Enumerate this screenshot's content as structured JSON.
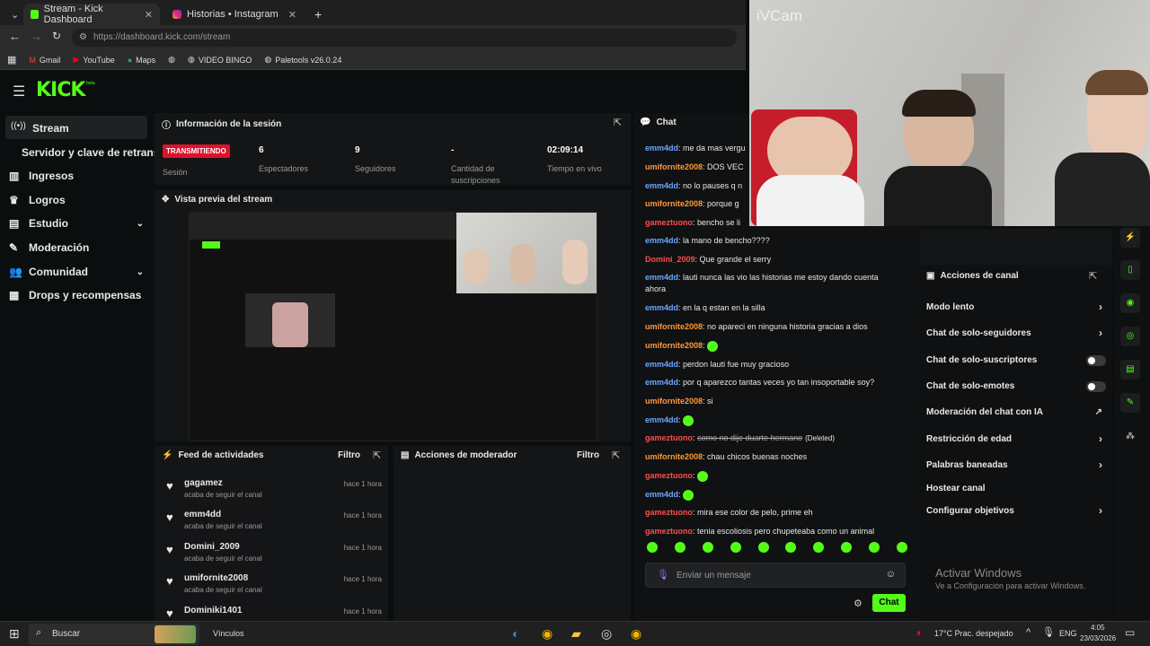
{
  "browser": {
    "tabs": [
      {
        "title": "Stream - Kick Dashboard"
      },
      {
        "title": "Historias • Instagram"
      }
    ],
    "url": "https://dashboard.kick.com/stream",
    "bookmarks": [
      "Gmail",
      "YouTube",
      "Maps",
      "VIDEO BINGO",
      "Paletools v26.0.24"
    ]
  },
  "kick": {
    "logo": "KICK",
    "logo_sup": "beta",
    "sidebar": [
      {
        "label": "Stream"
      },
      {
        "label": "Servidor y clave de retransmisión"
      },
      {
        "label": "Ingresos"
      },
      {
        "label": "Logros"
      },
      {
        "label": "Estudio"
      },
      {
        "label": "Moderación"
      },
      {
        "label": "Comunidad"
      },
      {
        "label": "Drops y recompensas"
      }
    ],
    "session": {
      "title": "Información de la sesión",
      "status_badge": "TRANSMITIENDO",
      "status_label": "Sesión",
      "viewers": "6",
      "viewers_label": "Espectadores",
      "followers": "9",
      "followers_label": "Seguidores",
      "subs": "-",
      "subs_label": "Cantidad de suscripciones",
      "time": "02:09:14",
      "time_label": "Tiempo en vivo"
    },
    "preview_title": "Vista previa del stream",
    "feed": {
      "title": "Feed de actividades",
      "filter": "Filtro",
      "items": [
        {
          "name": "gagamez",
          "sub": "acaba de seguir el canal",
          "time": "hace 1 hora"
        },
        {
          "name": "emm4dd",
          "sub": "acaba de seguir el canal",
          "time": "hace 1 hora"
        },
        {
          "name": "Domini_2009",
          "sub": "acaba de seguir el canal",
          "time": "hace 1 hora"
        },
        {
          "name": "umifornite2008",
          "sub": "acaba de seguir el canal",
          "time": "hace 1 hora"
        },
        {
          "name": "Dominiki1401",
          "sub": "",
          "time": "hace 1 hora"
        }
      ]
    },
    "mod_actions": {
      "title": "Acciones de moderador",
      "filter": "Filtro"
    },
    "chat": {
      "title": "Chat",
      "lines": [
        {
          "user": "emm4dd",
          "text": "me da mas vergu",
          "color": "#6ea8ff"
        },
        {
          "user": "umifornite2008",
          "text": "DOS VEC",
          "color": "#ff9a3c"
        },
        {
          "user": "emm4dd",
          "text": "no lo pauses q n",
          "color": "#6ea8ff"
        },
        {
          "user": "umifornite2008",
          "text": "porque g",
          "color": "#ff9a3c"
        },
        {
          "user": "gameztuono",
          "text": "bencho se li",
          "color": "#ff4d4d"
        },
        {
          "user": "emm4dd",
          "text": "la mano de bencho????",
          "color": "#6ea8ff"
        },
        {
          "user": "Domini_2009",
          "text": "Que grande el serry",
          "color": "#ff4d4d"
        },
        {
          "user": "emm4dd",
          "text": "lauti nunca las vio las historias me estoy dando cuenta ahora",
          "color": "#6ea8ff"
        },
        {
          "user": "emm4dd",
          "text": "en la q estan en la silla",
          "color": "#6ea8ff"
        },
        {
          "user": "umifornite2008",
          "text": "no apareci en ninguna historia gracias a dios",
          "color": "#ff9a3c"
        },
        {
          "user": "umifornite2008",
          "text": "",
          "color": "#ff9a3c"
        },
        {
          "user": "emm4dd",
          "text": "perdon lauti fue muy gracioso",
          "color": "#6ea8ff"
        },
        {
          "user": "emm4dd",
          "text": "por q aparezco tantas veces yo tan insoportable soy?",
          "color": "#6ea8ff"
        },
        {
          "user": "umifornite2008",
          "text": "si",
          "color": "#ff9a3c"
        },
        {
          "user": "emm4dd",
          "text": "",
          "color": "#6ea8ff"
        },
        {
          "user": "gameztuono",
          "text": "como no dije duarte hermano",
          "deleted": "(Deleted)",
          "color": "#ff4d4d"
        },
        {
          "user": "umifornite2008",
          "text": "chau chicos buenas noches",
          "color": "#ff9a3c"
        },
        {
          "user": "gameztuono",
          "text": "",
          "color": "#ff4d4d"
        },
        {
          "user": "emm4dd",
          "text": "",
          "color": "#6ea8ff"
        },
        {
          "user": "gameztuono",
          "text": "mira ese color de pelo, prime eh",
          "color": "#ff4d4d"
        },
        {
          "user": "gameztuono",
          "text": "tenia escoliosis pero chupeteaba como un animal",
          "color": "#ff4d4d"
        }
      ],
      "placeholder": "Enviar un mensaje",
      "send": "Chat"
    },
    "channel_actions": {
      "title": "Acciones de canal",
      "items": [
        {
          "label": "Modo lento",
          "kind": "chevron"
        },
        {
          "label": "Chat de solo-seguidores",
          "kind": "chevron"
        },
        {
          "label": "Chat de solo-suscriptores",
          "kind": "toggle"
        },
        {
          "label": "Chat de solo-emotes",
          "kind": "toggle"
        },
        {
          "label": "Moderación del chat con IA",
          "kind": "external"
        },
        {
          "label": "Restricción de edad",
          "kind": "chevron"
        },
        {
          "label": "Palabras baneadas",
          "kind": "chevron"
        },
        {
          "label": "Hostear canal",
          "kind": "none"
        },
        {
          "label": "Configurar objetivos",
          "kind": "chevron"
        }
      ]
    }
  },
  "webcam": {
    "label": "iVCam"
  },
  "windows": {
    "activate_title": "Activar Windows",
    "activate_sub": "Ve a Configuración para activar Windows.",
    "search": "Buscar",
    "vinculos": "Vínculos",
    "weather": "17°C  Prac. despejado",
    "lang": "ENG",
    "time": "4:05",
    "date": "23/03/2026"
  },
  "colors": {
    "accent": "#53fc18",
    "live": "#e0112b"
  }
}
